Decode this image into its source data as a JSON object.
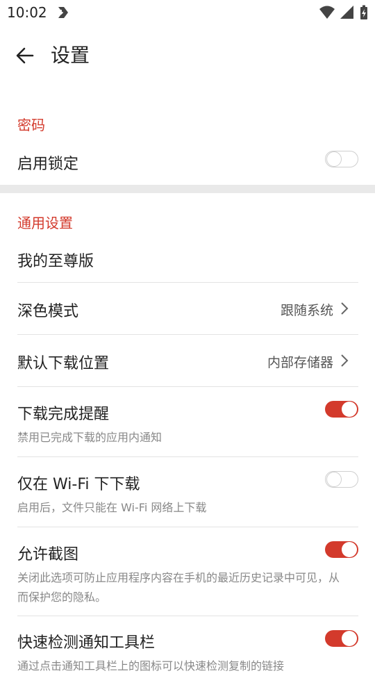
{
  "status_bar": {
    "time": "10:02"
  },
  "header": {
    "title": "设置"
  },
  "sections": {
    "password": {
      "title": "密码",
      "enable_lock": {
        "label": "启用锁定",
        "enabled": false
      }
    },
    "general": {
      "title": "通用设置",
      "premium": {
        "label": "我的至尊版"
      },
      "dark_mode": {
        "label": "深色模式",
        "value": "跟随系统"
      },
      "download_location": {
        "label": "默认下载位置",
        "value": "内部存储器"
      },
      "download_reminder": {
        "label": "下载完成提醒",
        "sub": "禁用已完成下载的应用内通知",
        "enabled": true
      },
      "wifi_only": {
        "label": "仅在 Wi-Fi 下下载",
        "sub": "启用后，文件只能在 Wi-Fi 网络上下载",
        "enabled": false
      },
      "allow_screenshot": {
        "label": "允许截图",
        "sub": "关闭此选项可防止应用程序内容在手机的最近历史记录中可见，从而保护您的隐私。",
        "enabled": true
      },
      "quick_detect": {
        "label": "快速检测通知工具栏",
        "sub": "通过点击通知工具栏上的图标可以快速检测复制的链接",
        "enabled": true
      }
    }
  },
  "colors": {
    "accent": "#d33a2c"
  },
  "icons": [
    "download-notification-icon",
    "wifi-icon",
    "signal-icon",
    "battery-icon",
    "back-arrow-icon",
    "chevron-right-icon"
  ]
}
